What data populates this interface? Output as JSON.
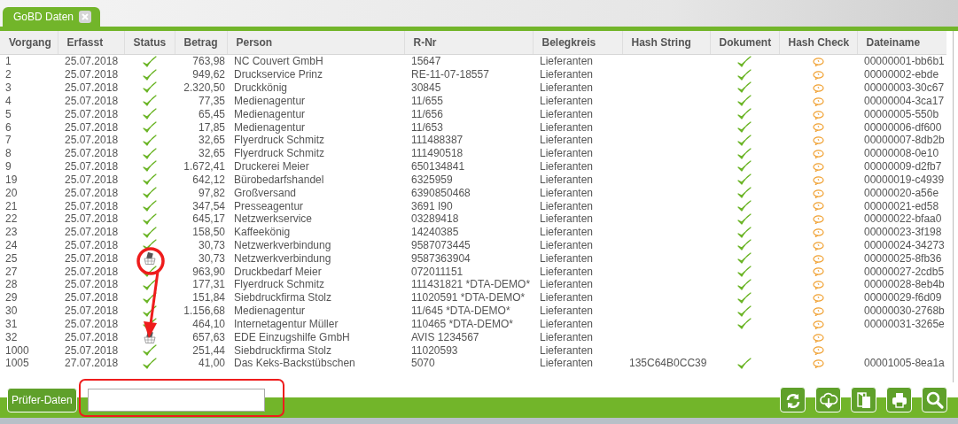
{
  "tabs": [
    {
      "label": "GoBD Daten",
      "selected": true
    }
  ],
  "table": {
    "columns": [
      "Vorgang",
      "Erfasst",
      "Status",
      "Betrag",
      "Person",
      "R-Nr",
      "Belegkreis",
      "Hash String",
      "Dokument",
      "Hash Check",
      "Dateiname"
    ],
    "rows": [
      {
        "vorgang": "1",
        "erfasst": "25.07.2018",
        "basket": false,
        "betrag": "763,98",
        "person": "NC Couvert GmbH",
        "r_nr": "15647",
        "belegkreis": "Lieferanten",
        "dokument": true,
        "hash_check": true,
        "dateiname": "00000001-bb6b1"
      },
      {
        "vorgang": "2",
        "erfasst": "25.07.2018",
        "basket": false,
        "betrag": "949,62",
        "person": "Druckservice Prinz",
        "r_nr": "RE-11-07-18557",
        "belegkreis": "Lieferanten",
        "dokument": true,
        "hash_check": true,
        "dateiname": "00000002-ebde"
      },
      {
        "vorgang": "3",
        "erfasst": "25.07.2018",
        "basket": false,
        "betrag": "2.320,50",
        "person": "Druckkönig",
        "r_nr": "30845",
        "belegkreis": "Lieferanten",
        "dokument": true,
        "hash_check": true,
        "dateiname": "00000003-30c67"
      },
      {
        "vorgang": "4",
        "erfasst": "25.07.2018",
        "basket": false,
        "betrag": "77,35",
        "person": "Medienagentur",
        "r_nr": "11/655",
        "belegkreis": "Lieferanten",
        "dokument": true,
        "hash_check": true,
        "dateiname": "00000004-3ca17"
      },
      {
        "vorgang": "5",
        "erfasst": "25.07.2018",
        "basket": false,
        "betrag": "65,45",
        "person": "Medienagentur",
        "r_nr": "11/656",
        "belegkreis": "Lieferanten",
        "dokument": true,
        "hash_check": true,
        "dateiname": "00000005-550b"
      },
      {
        "vorgang": "6",
        "erfasst": "25.07.2018",
        "basket": false,
        "betrag": "17,85",
        "person": "Medienagentur",
        "r_nr": "11/653",
        "belegkreis": "Lieferanten",
        "dokument": true,
        "hash_check": true,
        "dateiname": "00000006-df600"
      },
      {
        "vorgang": "7",
        "erfasst": "25.07.2018",
        "basket": false,
        "betrag": "32,65",
        "person": "Flyerdruck Schmitz",
        "r_nr": "111488387",
        "belegkreis": "Lieferanten",
        "dokument": true,
        "hash_check": true,
        "dateiname": "00000007-8db2b"
      },
      {
        "vorgang": "8",
        "erfasst": "25.07.2018",
        "basket": false,
        "betrag": "32,65",
        "person": "Flyerdruck Schmitz",
        "r_nr": "111490518",
        "belegkreis": "Lieferanten",
        "dokument": true,
        "hash_check": true,
        "dateiname": "00000008-0e10"
      },
      {
        "vorgang": "9",
        "erfasst": "25.07.2018",
        "basket": false,
        "betrag": "1.672,41",
        "person": "Druckerei Meier",
        "r_nr": "650134841",
        "belegkreis": "Lieferanten",
        "dokument": true,
        "hash_check": true,
        "dateiname": "00000009-d2fb7"
      },
      {
        "vorgang": "19",
        "erfasst": "25.07.2018",
        "basket": false,
        "betrag": "642,12",
        "person": "Bürobedarfshandel",
        "r_nr": "6325959",
        "belegkreis": "Lieferanten",
        "dokument": true,
        "hash_check": true,
        "dateiname": "00000019-c4939"
      },
      {
        "vorgang": "20",
        "erfasst": "25.07.2018",
        "basket": false,
        "betrag": "97,82",
        "person": "Großversand",
        "r_nr": "6390850468",
        "belegkreis": "Lieferanten",
        "dokument": true,
        "hash_check": true,
        "dateiname": "00000020-a56e"
      },
      {
        "vorgang": "21",
        "erfasst": "25.07.2018",
        "basket": false,
        "betrag": "347,54",
        "person": "Presseagentur",
        "r_nr": "3691 I90",
        "belegkreis": "Lieferanten",
        "dokument": true,
        "hash_check": true,
        "dateiname": "00000021-ed58"
      },
      {
        "vorgang": "22",
        "erfasst": "25.07.2018",
        "basket": false,
        "betrag": "645,17",
        "person": "Netzwerkservice",
        "r_nr": "03289418",
        "belegkreis": "Lieferanten",
        "dokument": true,
        "hash_check": true,
        "dateiname": "00000022-bfaa0"
      },
      {
        "vorgang": "23",
        "erfasst": "25.07.2018",
        "basket": false,
        "betrag": "158,50",
        "person": "Kaffeekönig",
        "r_nr": "14240385",
        "belegkreis": "Lieferanten",
        "dokument": true,
        "hash_check": true,
        "dateiname": "00000023-3f198"
      },
      {
        "vorgang": "24",
        "erfasst": "25.07.2018",
        "basket": false,
        "betrag": "30,73",
        "person": "Netzwerkverbindung",
        "r_nr": "9587073445",
        "belegkreis": "Lieferanten",
        "dokument": true,
        "hash_check": true,
        "dateiname": "00000024-34273"
      },
      {
        "vorgang": "25",
        "erfasst": "25.07.2018",
        "basket": true,
        "betrag": "30,73",
        "person": "Netzwerkverbindung",
        "r_nr": "9587363904",
        "belegkreis": "Lieferanten",
        "dokument": true,
        "hash_check": true,
        "dateiname": "00000025-8fb36"
      },
      {
        "vorgang": "27",
        "erfasst": "25.07.2018",
        "basket": false,
        "betrag": "963,90",
        "person": "Druckbedarf Meier",
        "r_nr": "072011151",
        "belegkreis": "Lieferanten",
        "dokument": true,
        "hash_check": true,
        "dateiname": "00000027-2cdb5"
      },
      {
        "vorgang": "28",
        "erfasst": "25.07.2018",
        "basket": false,
        "betrag": "177,31",
        "person": "Flyerdruck Schmitz",
        "r_nr": "111431821 *DTA-DEMO*",
        "belegkreis": "Lieferanten",
        "dokument": true,
        "hash_check": true,
        "dateiname": "00000028-8eb4b"
      },
      {
        "vorgang": "29",
        "erfasst": "25.07.2018",
        "basket": false,
        "betrag": "151,84",
        "person": "Siebdruckfirma Stolz",
        "r_nr": "11020591 *DTA-DEMO*",
        "belegkreis": "Lieferanten",
        "dokument": true,
        "hash_check": true,
        "dateiname": "00000029-f6d09"
      },
      {
        "vorgang": "30",
        "erfasst": "25.07.2018",
        "basket": false,
        "betrag": "1.156,68",
        "person": "Medienagentur",
        "r_nr": "11/645 *DTA-DEMO*",
        "belegkreis": "Lieferanten",
        "dokument": true,
        "hash_check": true,
        "dateiname": "00000030-2768b"
      },
      {
        "vorgang": "31",
        "erfasst": "25.07.2018",
        "basket": false,
        "betrag": "464,10",
        "person": "Internetagentur Müller",
        "r_nr": "110465 *DTA-DEMO*",
        "belegkreis": "Lieferanten",
        "dokument": true,
        "hash_check": true,
        "dateiname": "00000031-3265e"
      },
      {
        "vorgang": "32",
        "erfasst": "25.07.2018",
        "basket": true,
        "betrag": "657,63",
        "person": "EDE Einzugshilfe GmbH",
        "r_nr": "AVIS 1234567",
        "belegkreis": "Lieferanten",
        "dokument": false,
        "hash_check": true
      },
      {
        "vorgang": "1000",
        "erfasst": "25.07.2018",
        "basket": false,
        "betrag": "251,44",
        "person": "Siebdruckfirma Stolz",
        "r_nr": "11020593",
        "belegkreis": "Lieferanten",
        "dokument": false,
        "hash_check": true
      },
      {
        "vorgang": "1005",
        "erfasst": "27.07.2018",
        "basket": false,
        "betrag": "41,00",
        "person": "Das Keks-Backstübschen",
        "r_nr": "5070",
        "belegkreis": "Lieferanten",
        "hash_string": "135C64B0CC39",
        "dokument": true,
        "hash_check": true,
        "dateiname": "00001005-8ea1a"
      }
    ]
  },
  "footer": {
    "button": "Prüfer-Daten",
    "tools": [
      {
        "kind": "refresh"
      },
      {
        "kind": "download"
      },
      {
        "kind": "copy"
      },
      {
        "kind": "print"
      },
      {
        "kind": "search"
      }
    ]
  },
  "annotations": [
    {
      "kind": "circle"
    },
    {
      "kind": "arrow"
    },
    {
      "kind": "frame"
    }
  ]
}
